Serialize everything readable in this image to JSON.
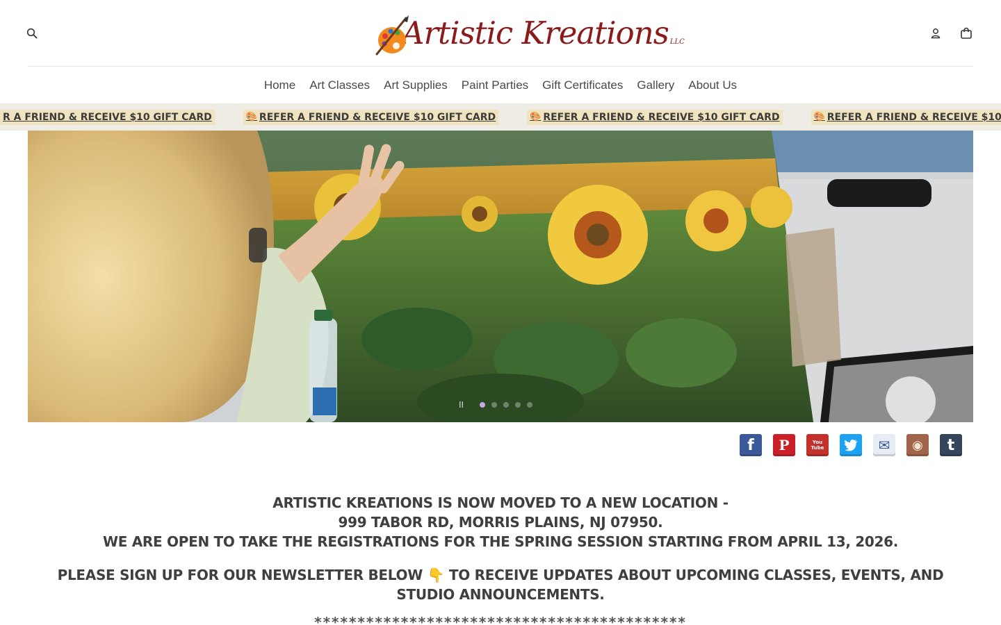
{
  "header": {
    "logo_text": "Artistic Kreations",
    "logo_suffix": "LLC",
    "search_icon": "search-icon",
    "account_icon": "user-icon",
    "cart_icon": "shopping-bag-icon"
  },
  "nav": {
    "items": [
      {
        "label": "Home"
      },
      {
        "label": "Art Classes"
      },
      {
        "label": "Art Supplies"
      },
      {
        "label": "Paint Parties"
      },
      {
        "label": "Gift Certificates"
      },
      {
        "label": "Gallery"
      },
      {
        "label": "About Us"
      }
    ]
  },
  "marquee": {
    "emoji": "🎨",
    "text": "REFER A FRIEND & RECEIVE $10 GIFT CARD",
    "first_text": "R A FRIEND & RECEIVE $10 GIFT CARD"
  },
  "slider": {
    "pause_label": "II",
    "dot_count": 5,
    "active_index": 0
  },
  "social": [
    {
      "name": "facebook-icon",
      "glyph": "f",
      "color": "#3b5998"
    },
    {
      "name": "pinterest-icon",
      "glyph": "P",
      "color": "#cb2027"
    },
    {
      "name": "youtube-icon",
      "glyph": "You Tube",
      "color": "#c4302b"
    },
    {
      "name": "twitter-icon",
      "glyph": "t",
      "color": "#1da1f2"
    },
    {
      "name": "email-icon",
      "glyph": "✉",
      "color": "#e8edf5"
    },
    {
      "name": "instagram-icon",
      "glyph": "◉",
      "color": "#a0654a"
    },
    {
      "name": "tumblr-icon",
      "glyph": "t",
      "color": "#35465c"
    }
  ],
  "announcement": {
    "line1": "ARTISTIC KREATIONS IS NOW MOVED TO A NEW LOCATION -",
    "line2": "999 TABOR RD, MORRIS PLAINS, NJ 07950.",
    "line3": "WE ARE OPEN TO TAKE THE REGISTRATIONS FOR THE SPRING SESSION STARTING FROM APRIL 13, 2026.",
    "line4": "PLEASE SIGN UP FOR OUR NEWSLETTER BELOW 👇 TO RECEIVE UPDATES ABOUT UPCOMING CLASSES, EVENTS, AND",
    "line5": "STUDIO ANNOUNCEMENTS.",
    "divider": "*******************************************"
  }
}
